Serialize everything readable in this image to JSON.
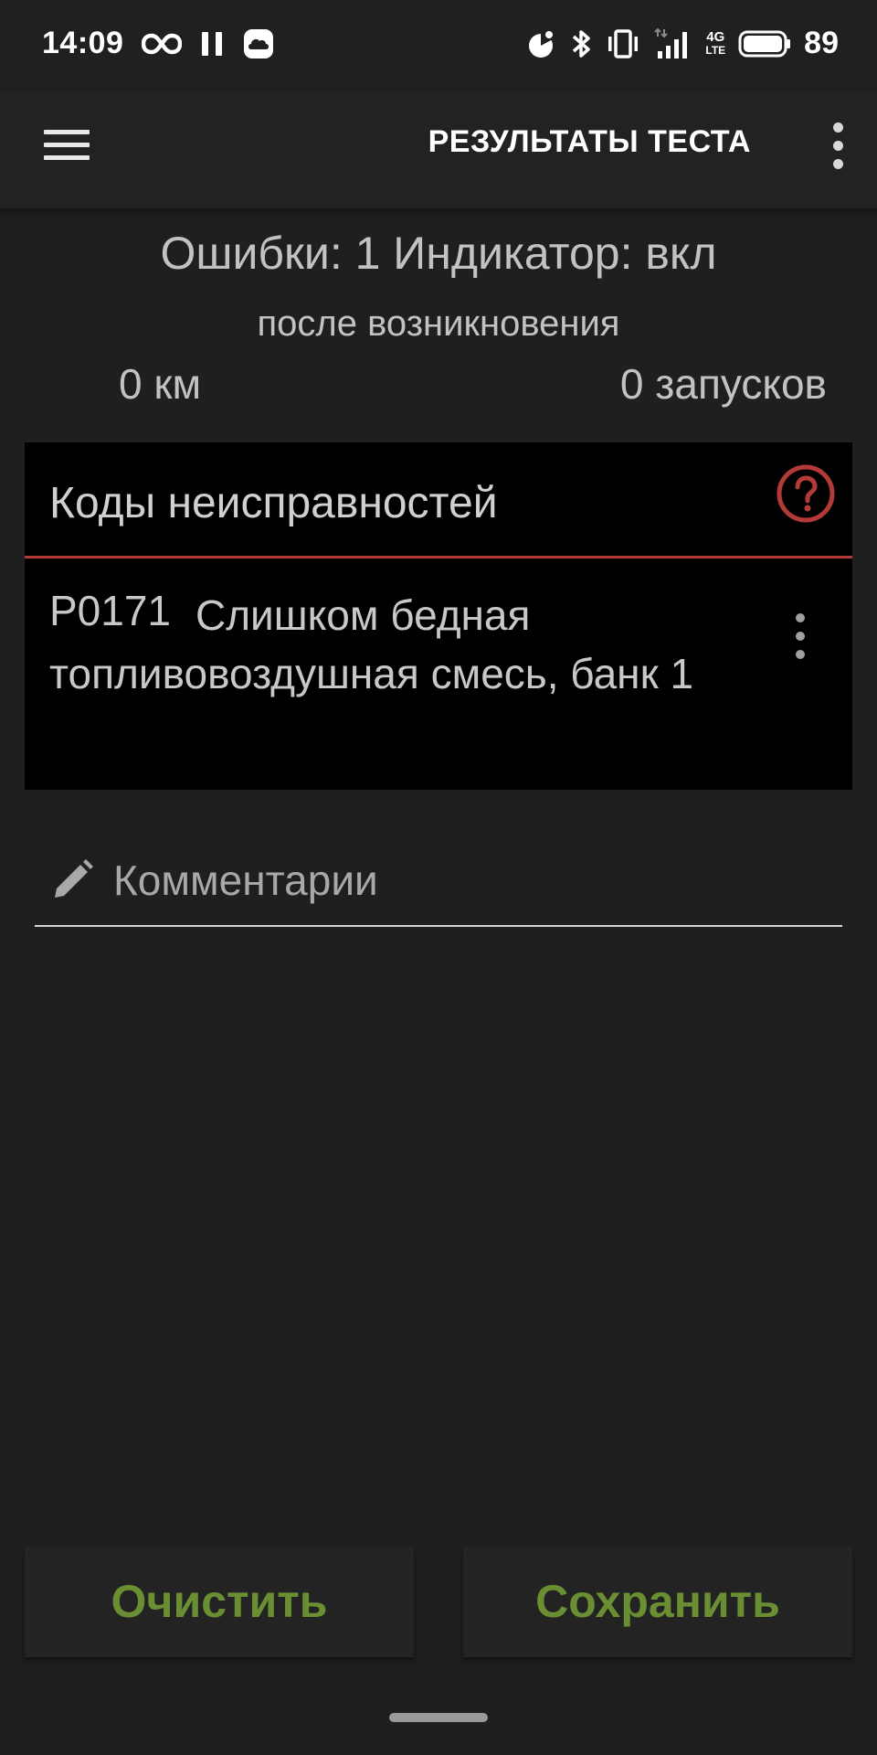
{
  "status_bar": {
    "time": "14:09",
    "network_type_top": "4G",
    "network_type_bottom": "LTE",
    "battery_percent": "89",
    "icons": [
      "infinity-icon",
      "pause-icon",
      "cloud-icon",
      "data-saver-icon",
      "bluetooth-icon",
      "vibrate-icon",
      "signal-icon",
      "battery-icon"
    ]
  },
  "app_bar": {
    "title": "РЕЗУЛЬТАТЫ ТЕСТА"
  },
  "summary": {
    "errors_line": "Ошибки: 1 Индикатор: вкл",
    "since_label": "после возникновения",
    "km_value": "0 км",
    "starts_value": "0 запусков"
  },
  "dtc_section": {
    "title": "Коды неисправностей",
    "items": [
      {
        "code": "P0171",
        "description": "Слишком бедная топливовоздушная смесь, банк 1"
      }
    ]
  },
  "comments": {
    "placeholder": "Комментарии",
    "value": ""
  },
  "actions": {
    "clear_label": "Очистить",
    "save_label": "Сохранить"
  },
  "colors": {
    "accent_green": "#6a8f32",
    "accent_red": "#b43a3a",
    "background": "#1f1f1f",
    "card": "#000000"
  }
}
